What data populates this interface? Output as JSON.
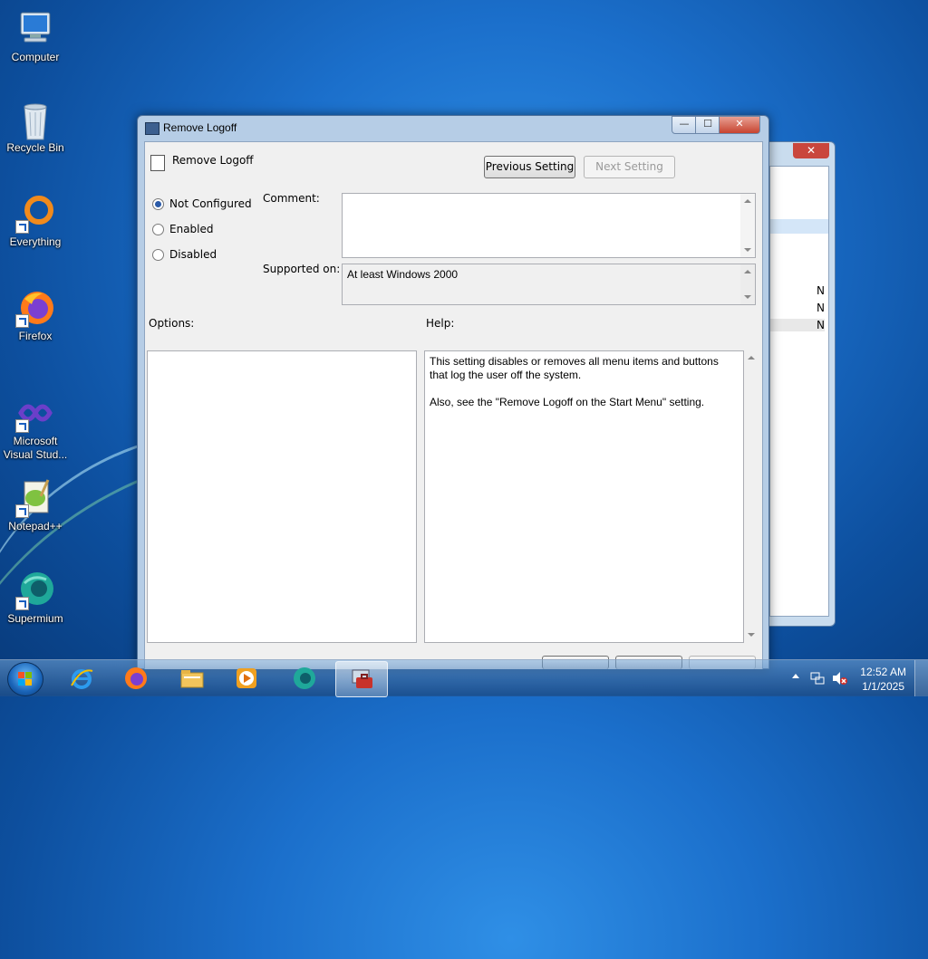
{
  "desktop": {
    "icons": [
      {
        "label": "Computer"
      },
      {
        "label": "Recycle Bin"
      },
      {
        "label": "Everything"
      },
      {
        "label": "Firefox"
      },
      {
        "label": "Microsoft Visual Stud..."
      },
      {
        "label": "Notepad++"
      },
      {
        "label": "Supermium"
      }
    ]
  },
  "background_window": {
    "close_symbol": "✕",
    "row_values": [
      "N",
      "N",
      "N"
    ]
  },
  "dialog": {
    "title": "Remove Logoff",
    "window_controls": {
      "minimize": "—",
      "maximize": "☐",
      "close": "✕"
    },
    "setting_name": "Remove Logoff",
    "previous_label": "Previous Setting",
    "next_label": "Next Setting",
    "options_state": {
      "not_configured": "Not Configured",
      "enabled": "Enabled",
      "disabled": "Disabled",
      "selected": "not_configured"
    },
    "comment_label": "Comment:",
    "comment_value": "",
    "supported_label": "Supported on:",
    "supported_value": "At least Windows 2000",
    "options_label": "Options:",
    "help_label": "Help:",
    "help_text": "This setting disables or removes all menu items and buttons that log the user off the system.\n\nAlso, see the \"Remove Logoff on the Start Menu\" setting."
  },
  "taskbar": {
    "clock_time": "12:52 AM",
    "clock_date": "1/1/2025",
    "pinned": [
      "internet-explorer-icon",
      "firefox-icon",
      "file-explorer-icon",
      "media-player-icon",
      "supermium-icon",
      "group-policy-editor-icon"
    ]
  },
  "colors": {
    "desktop_blue": "#1b6fcb",
    "window_frame": "#b6cde6",
    "close_red": "#c7432f"
  }
}
